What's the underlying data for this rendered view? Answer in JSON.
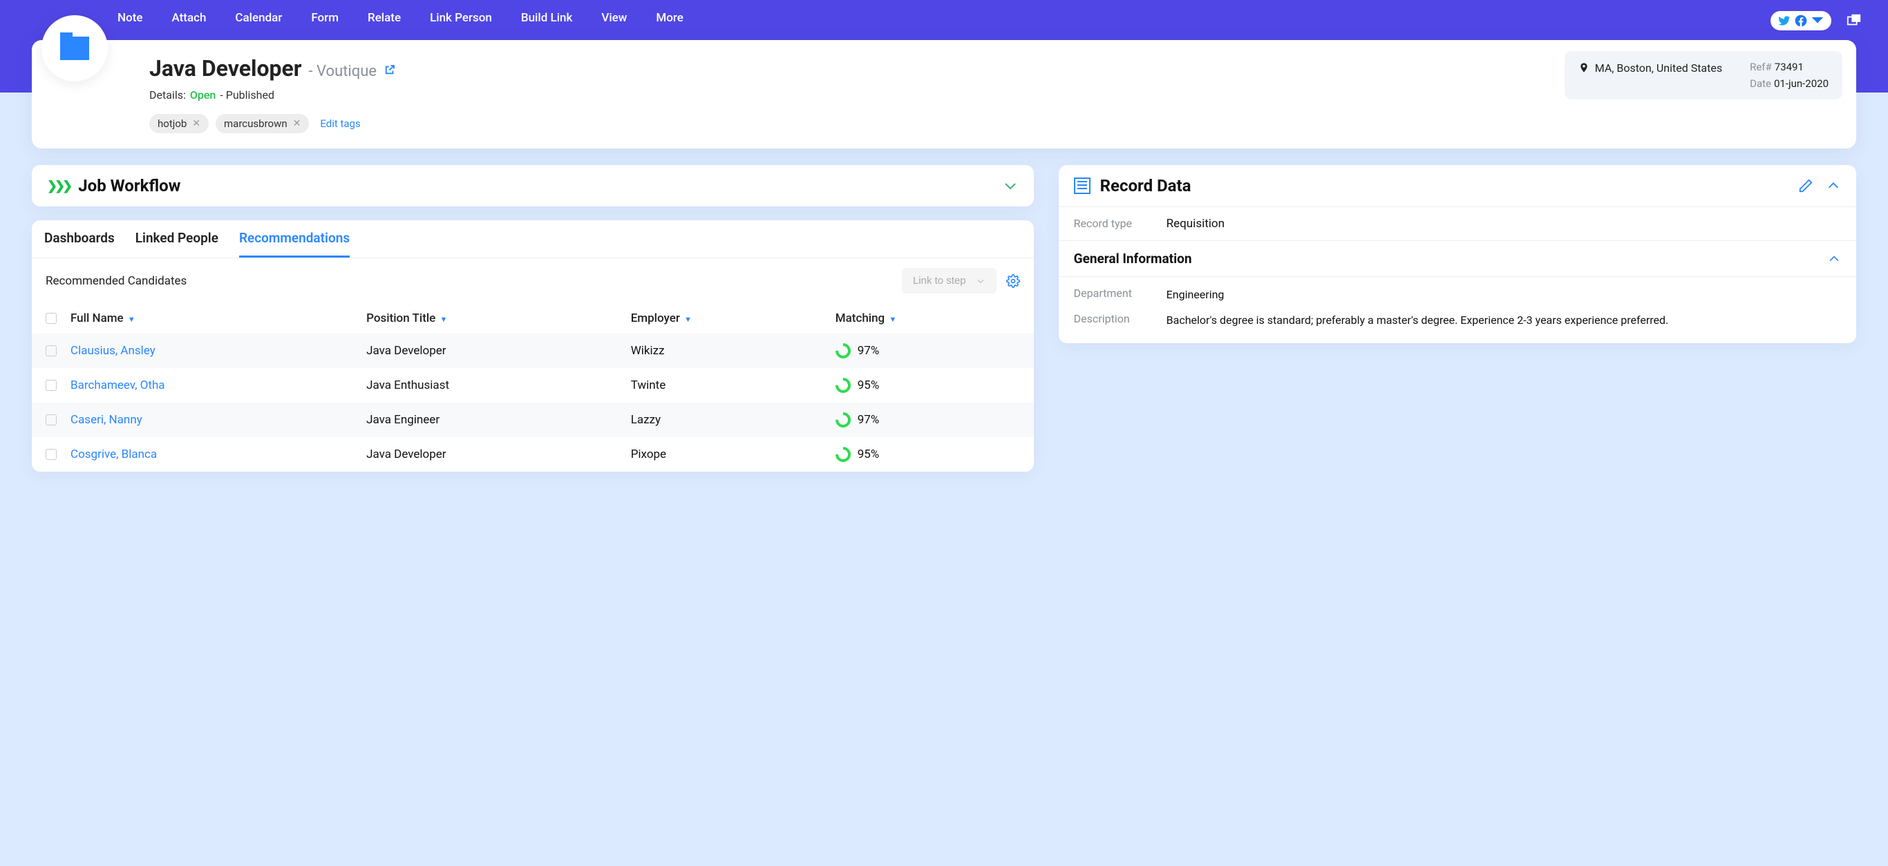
{
  "nav": {
    "items": [
      "Note",
      "Attach",
      "Calendar",
      "Form",
      "Relate",
      "Link Person",
      "Build Link",
      "View",
      "More"
    ]
  },
  "header": {
    "title": "Java Developer",
    "company": "- Voutique",
    "details_label": "Details:",
    "status": "Open",
    "status2": "- Published",
    "tags": [
      "hotjob",
      "marcusbrown"
    ],
    "edit_tags": "Edit tags",
    "location": "MA, Boston, United States",
    "ref_label": "Ref#",
    "ref_value": "73491",
    "date_label": "Date",
    "date_value": "01-jun-2020"
  },
  "workflow": {
    "title": "Job Workflow"
  },
  "tabs": {
    "dashboards": "Dashboards",
    "linked_people": "Linked People",
    "recommendations": "Recommendations"
  },
  "rec": {
    "title": "Recommended Candidates",
    "link_step": "Link to step",
    "cols": {
      "name": "Full Name",
      "position": "Position Title",
      "employer": "Employer",
      "matching": "Matching"
    },
    "rows": [
      {
        "name": "Clausius, Ansley",
        "position": "Java Developer",
        "employer": "Wikizz",
        "match": "97%"
      },
      {
        "name": "Barchameev, Otha",
        "position": "Java Enthusiast",
        "employer": "Twinte",
        "match": "95%"
      },
      {
        "name": "Caseri, Nanny",
        "position": "Java Engineer",
        "employer": "Lazzy",
        "match": "97%"
      },
      {
        "name": "Cosgrive, Blanca",
        "position": "Java Developer",
        "employer": "Pixope",
        "match": "95%"
      }
    ]
  },
  "record": {
    "title": "Record Data",
    "type_label": "Record type",
    "type_value": "Requisition",
    "gi_title": "General Information",
    "dept_label": "Department",
    "dept_value": "Engineering",
    "desc_label": "Description",
    "desc_value": "Bachelor's degree is standard; preferably a master's degree. Experience 2-3 years experience preferred."
  }
}
